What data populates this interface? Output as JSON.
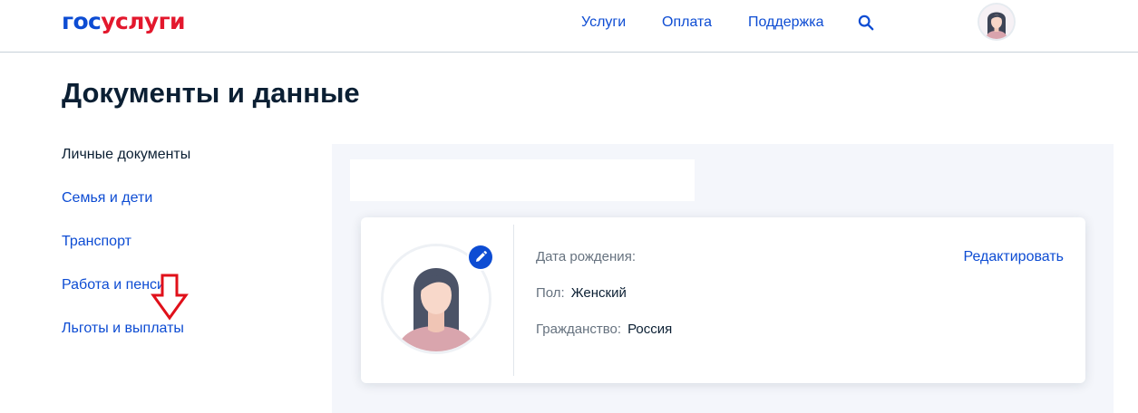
{
  "header": {
    "logo_part1": "гос",
    "logo_part2": "услуги",
    "nav": [
      "Услуги",
      "Оплата",
      "Поддержка"
    ],
    "search_icon": "search-icon",
    "avatar_icon": "avatar"
  },
  "page": {
    "title": "Документы и данные"
  },
  "sidebar": {
    "items": [
      {
        "label": "Личные документы",
        "active": true
      },
      {
        "label": "Семья и дети"
      },
      {
        "label": "Транспорт"
      },
      {
        "label": "Работа и пенсия"
      },
      {
        "label": "Льготы и выплаты"
      }
    ]
  },
  "profile": {
    "edit_link": "Редактировать",
    "birth_label": "Дата рождения:",
    "birth_value": "",
    "gender_label": "Пол:",
    "gender_value": "Женский",
    "citizenship_label": "Гражданство:",
    "citizenship_value": "Россия"
  },
  "colors": {
    "brand_blue": "#0d4cd3",
    "brand_red": "#e3182d",
    "text_dark": "#0b1f33",
    "annotation_arrow": "#e0101a"
  }
}
